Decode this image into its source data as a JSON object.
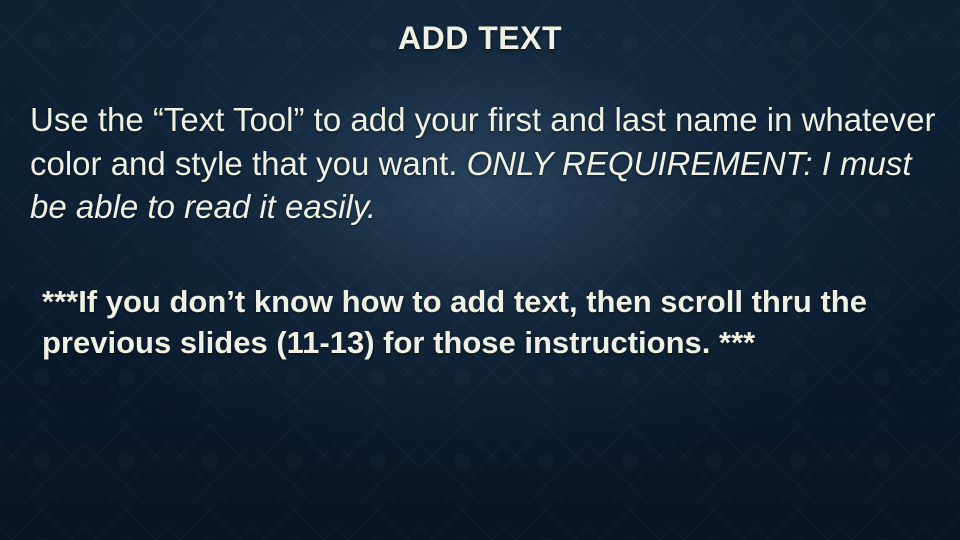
{
  "title": "ADD TEXT",
  "body1_normal": "Use the “Text Tool” to add your first and last name in whatever color and style that you want. ",
  "body1_req": "ONLY REQUIREMENT: I must be able to read it easily.",
  "body2": "***If you don’t know how to add text, then scroll thru the previous slides (11-13) for those instructions. ***"
}
